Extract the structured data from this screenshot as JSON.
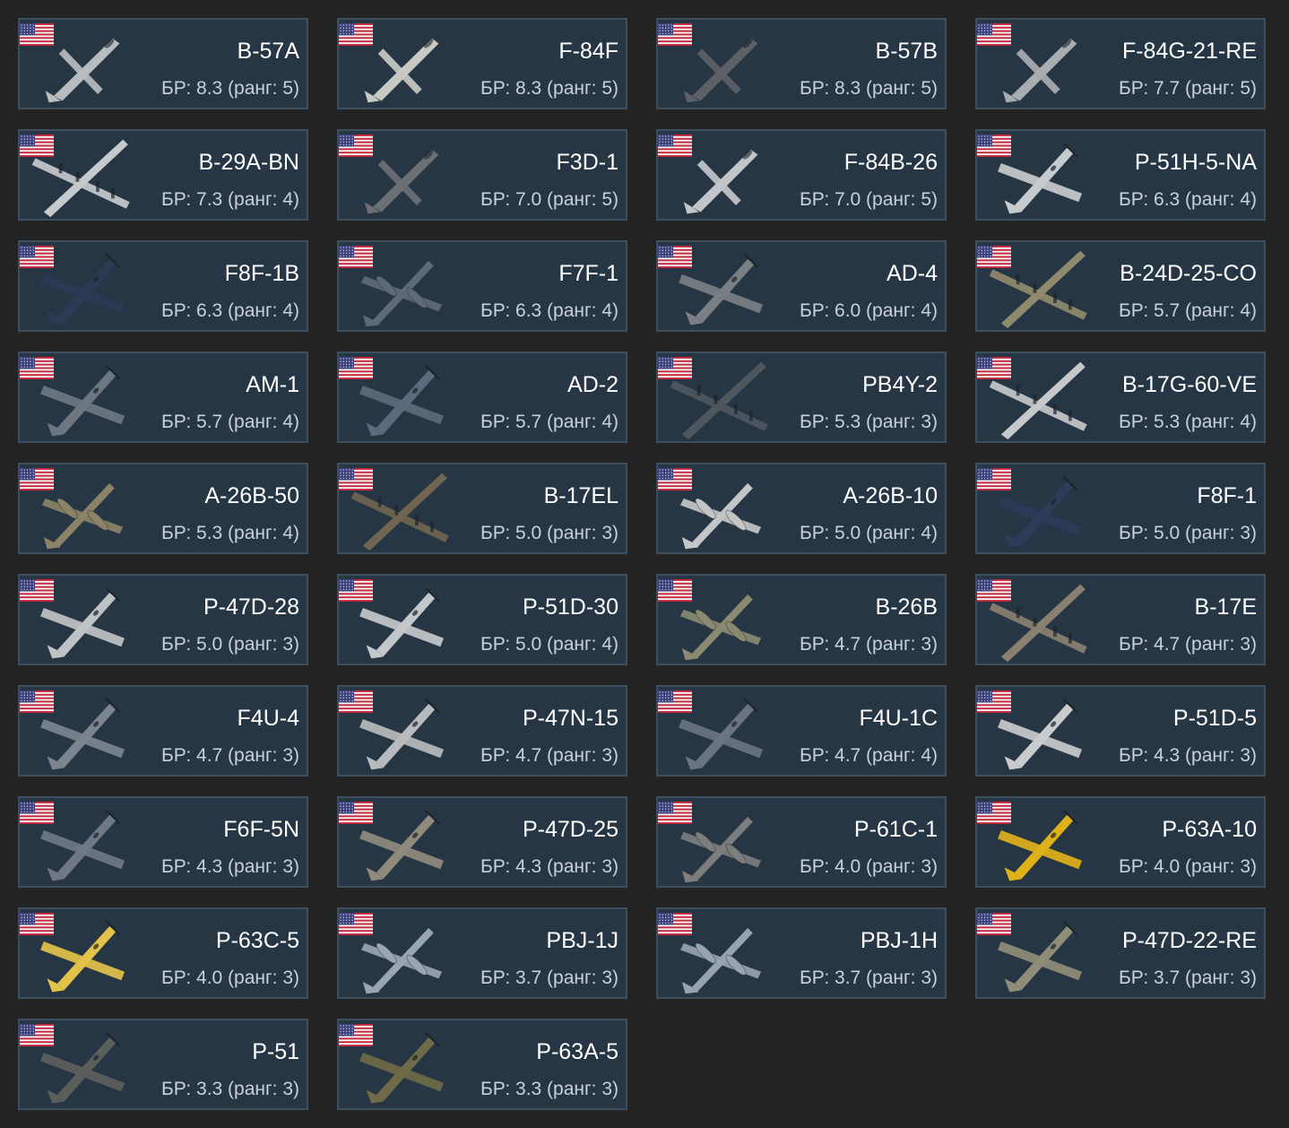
{
  "vehicles": [
    {
      "name": "B-57A",
      "br": "БР: 8.3 (ранг: 5)",
      "color": "#b9bcbf",
      "kind": "jet"
    },
    {
      "name": "F-84F",
      "br": "БР: 8.3 (ранг: 5)",
      "color": "#c9c9c4",
      "kind": "jet"
    },
    {
      "name": "B-57B",
      "br": "БР: 8.3 (ранг: 5)",
      "color": "#5d6166",
      "kind": "jet"
    },
    {
      "name": "F-84G-21-RE",
      "br": "БР: 7.7 (ранг: 5)",
      "color": "#a9adb0",
      "kind": "jet"
    },
    {
      "name": "B-29A-BN",
      "br": "БР: 7.3 (ранг: 4)",
      "color": "#c7cacd",
      "kind": "bomber"
    },
    {
      "name": "F3D-1",
      "br": "БР: 7.0 (ранг: 5)",
      "color": "#6c7075",
      "kind": "jet"
    },
    {
      "name": "F-84B-26",
      "br": "БР: 7.0 (ранг: 5)",
      "color": "#c3c6c9",
      "kind": "jet"
    },
    {
      "name": "P-51H-5-NA",
      "br": "БР: 6.3 (ранг: 4)",
      "color": "#c8cbcd",
      "kind": "fighter"
    },
    {
      "name": "F8F-1B",
      "br": "БР: 6.3 (ранг: 4)",
      "color": "#2c3a56",
      "kind": "fighter"
    },
    {
      "name": "F7F-1",
      "br": "БР: 6.3 (ранг: 4)",
      "color": "#5e6a78",
      "kind": "twin"
    },
    {
      "name": "AD-4",
      "br": "БР: 6.0 (ранг: 4)",
      "color": "#7a7f84",
      "kind": "fighter"
    },
    {
      "name": "B-24D-25-CO",
      "br": "БР: 5.7 (ранг: 4)",
      "color": "#8f8a6c",
      "kind": "bomber"
    },
    {
      "name": "AM-1",
      "br": "БР: 5.7 (ранг: 4)",
      "color": "#6d7782",
      "kind": "fighter"
    },
    {
      "name": "AD-2",
      "br": "БР: 5.7 (ранг: 4)",
      "color": "#5c6a7b",
      "kind": "fighter"
    },
    {
      "name": "PB4Y-2",
      "br": "БР: 5.3 (ранг: 3)",
      "color": "#4e565e",
      "kind": "bomber"
    },
    {
      "name": "B-17G-60-VE",
      "br": "БР: 5.3 (ранг: 4)",
      "color": "#c6c8ca",
      "kind": "bomber"
    },
    {
      "name": "A-26B-50",
      "br": "БР: 5.3 (ранг: 4)",
      "color": "#8c8268",
      "kind": "twin"
    },
    {
      "name": "B-17EL",
      "br": "БР: 5.0 (ранг: 3)",
      "color": "#6f6550",
      "kind": "bomber"
    },
    {
      "name": "A-26B-10",
      "br": "БР: 5.0 (ранг: 4)",
      "color": "#c3c5c7",
      "kind": "twin"
    },
    {
      "name": "F8F-1",
      "br": "БР: 5.0 (ранг: 3)",
      "color": "#2e3b59",
      "kind": "fighter"
    },
    {
      "name": "P-47D-28",
      "br": "БР: 5.0 (ранг: 3)",
      "color": "#c0c3c6",
      "kind": "fighter"
    },
    {
      "name": "P-51D-30",
      "br": "БР: 5.0 (ранг: 4)",
      "color": "#c4c7ca",
      "kind": "fighter"
    },
    {
      "name": "B-26B",
      "br": "БР: 4.7 (ранг: 3)",
      "color": "#8a8a70",
      "kind": "twin"
    },
    {
      "name": "B-17E",
      "br": "БР: 4.7 (ранг: 3)",
      "color": "#8a8070",
      "kind": "bomber"
    },
    {
      "name": "F4U-4",
      "br": "БР: 4.7 (ранг: 3)",
      "color": "#7b8590",
      "kind": "fighter"
    },
    {
      "name": "P-47N-15",
      "br": "БР: 4.7 (ранг: 3)",
      "color": "#b8bbbd",
      "kind": "fighter"
    },
    {
      "name": "F4U-1C",
      "br": "БР: 4.7 (ранг: 4)",
      "color": "#6a7480",
      "kind": "fighter"
    },
    {
      "name": "P-51D-5",
      "br": "БР: 4.3 (ранг: 3)",
      "color": "#c9cbcd",
      "kind": "fighter"
    },
    {
      "name": "F6F-5N",
      "br": "БР: 4.3 (ранг: 3)",
      "color": "#6f7884",
      "kind": "fighter"
    },
    {
      "name": "P-47D-25",
      "br": "БР: 4.3 (ранг: 3)",
      "color": "#8e8a7c",
      "kind": "fighter"
    },
    {
      "name": "P-61C-1",
      "br": "БР: 4.0 (ранг: 3)",
      "color": "#7d7d7d",
      "kind": "twin"
    },
    {
      "name": "P-63A-10",
      "br": "БР: 4.0 (ранг: 3)",
      "color": "#e0b21a",
      "kind": "fighter"
    },
    {
      "name": "P-63C-5",
      "br": "БР: 4.0 (ранг: 3)",
      "color": "#e3c24a",
      "kind": "fighter"
    },
    {
      "name": "PBJ-1J",
      "br": "БР: 3.7 (ранг: 3)",
      "color": "#9aa5b2",
      "kind": "twin"
    },
    {
      "name": "PBJ-1H",
      "br": "БР: 3.7 (ранг: 3)",
      "color": "#98a3b0",
      "kind": "twin"
    },
    {
      "name": "P-47D-22-RE",
      "br": "БР: 3.7 (ранг: 3)",
      "color": "#8f8c78",
      "kind": "fighter"
    },
    {
      "name": "P-51",
      "br": "БР: 3.3 (ранг: 3)",
      "color": "#5c5e5c",
      "kind": "fighter"
    },
    {
      "name": "P-63A-5",
      "br": "БР: 3.3 (ранг: 3)",
      "color": "#6f6a48",
      "kind": "fighter"
    }
  ],
  "flag_icon": "us-flag-icon",
  "plane_icon": "aircraft-icon"
}
